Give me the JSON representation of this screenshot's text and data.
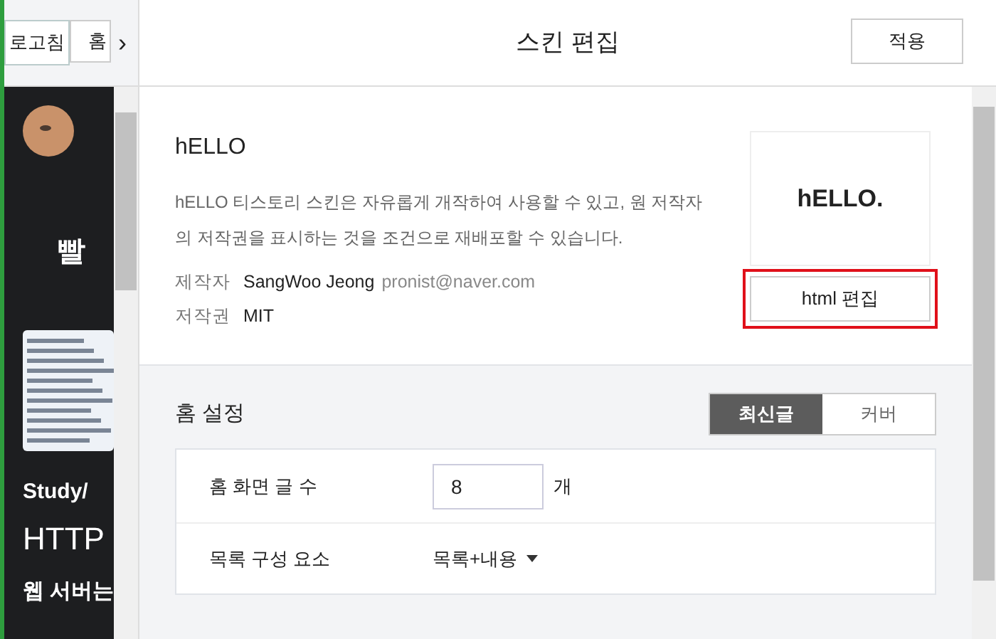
{
  "preview_toolbar": {
    "refresh_button": "로고침",
    "home_button": "홈",
    "collapse_button": "›"
  },
  "preview": {
    "title": "빨",
    "category": "Study/",
    "post_title": "HTTP",
    "post_excerpt": "웹 서버는"
  },
  "header": {
    "title": "스킨 편집",
    "apply_button": "적용"
  },
  "skin": {
    "name": "hELLO",
    "description": "hELLO 티스토리 스킨은 자유롭게 개작하여 사용할 수 있고, 원 저작자의 저작권을 표시하는 것을 조건으로 재배포할 수 있습니다.",
    "meta": [
      {
        "label": "제작자",
        "value": "SangWoo Jeong",
        "extra": "pronist@naver.com"
      },
      {
        "label": "저작권",
        "value": "MIT"
      }
    ],
    "thumbnail_text": "hELLO.",
    "html_edit_button": "html 편집",
    "html_edit_highlighted": true
  },
  "home_settings": {
    "title": "홈 설정",
    "tabs": [
      {
        "label": "최신글",
        "selected": true
      },
      {
        "label": "커버",
        "selected": false
      }
    ],
    "rows": [
      {
        "kind": "number",
        "label": "홈 화면 글 수",
        "value": "8",
        "unit": "개"
      },
      {
        "kind": "select",
        "label": "목록 구성 요소",
        "value": "목록+내용"
      }
    ]
  }
}
